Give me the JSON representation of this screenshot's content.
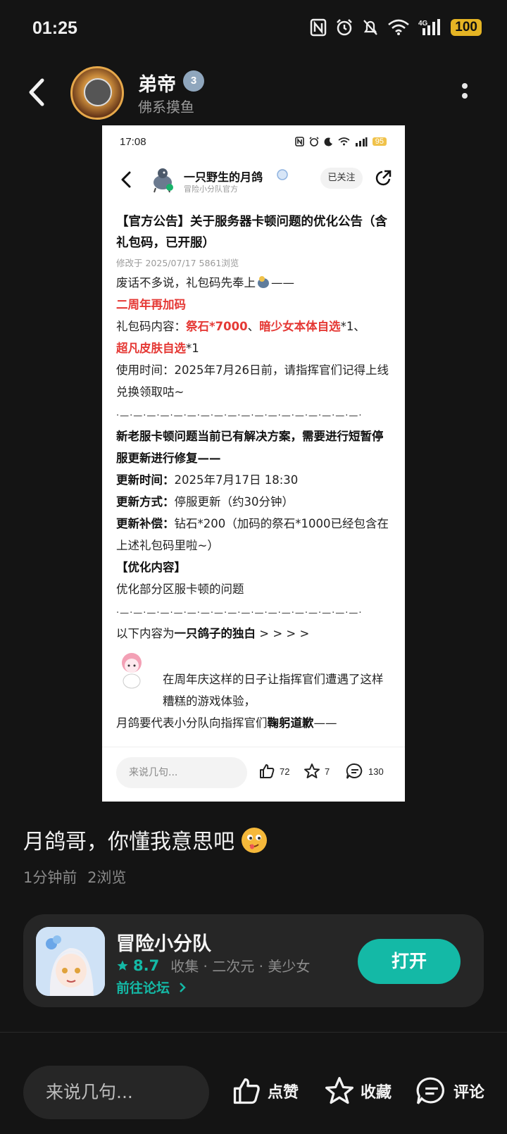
{
  "status_bar": {
    "time": "01:25",
    "network": "4G",
    "battery": "100"
  },
  "header": {
    "user_name": "弟帝",
    "level": "3",
    "user_subtitle": "佛系摸鱼"
  },
  "embedded_post": {
    "status_time": "17:08",
    "battery": "95",
    "author_name": "一只野生的月鸽",
    "author_subtitle": "冒险小分队官方",
    "follow_label": "已关注",
    "title": "【官方公告】关于服务器卡顿问题的优化公告（含礼包码，已开服）",
    "meta": "修改于 2025/07/17  5861浏览",
    "line1": "废话不多说，礼包码先奉上",
    "line1_tail": "——",
    "extra_code": "二周年再加码",
    "gift_prefix": "礼包码内容：",
    "gift_item1": "祭石*7000",
    "gift_sep": "、",
    "gift_item2": "暗少女本体自选",
    "gift_item2_tail": "*1、",
    "gift_item3": "超凡皮肤自选",
    "gift_item3_tail": "*1",
    "use_time": "使用时间：2025年7月26日前，请指挥官们记得上线兑换领取咕~",
    "dashes": "·—·—·—·—·—·—·—·—·—·—·—·—·—·—·—·—·—·—·",
    "server_heading": "新老服卡顿问题当前已有解决方案，需要进行短暂停服更新进行修复——",
    "update_time_label": "更新时间：",
    "update_time": "2025年7月17日 18:30",
    "update_method_label": "更新方式：",
    "update_method": "停服更新（约30分钟）",
    "update_comp_label": "更新补偿：",
    "update_comp": "钻石*200（加码的祭石*1000已经包含在上述礼包码里啦~）",
    "opt_heading": "【优化内容】",
    "opt_content": "优化部分区服卡顿的问题",
    "monologue_prefix": "以下内容为",
    "monologue_bold": "一只鸽子的独白",
    "monologue_tail": " > > > >",
    "para1": "在周年庆这样的日子让指挥官们遭遇了这样糟糕的游戏体验，",
    "para2_prefix": "月鸽要代表小分队向指挥官们",
    "para2_bold": "鞠躬道歉",
    "para2_tail": "——",
    "input_placeholder": "来说几句...",
    "likes": "72",
    "favorites": "7",
    "comments": "130"
  },
  "caption": "月鸽哥，你懂我意思吧",
  "post_meta": {
    "time_ago": "1分钟前",
    "views": "2浏览"
  },
  "game_card": {
    "name": "冒险小分队",
    "rating": "8.7",
    "tags": "收集 · 二次元 · 美少女",
    "forum_link": "前往论坛",
    "open_label": "打开"
  },
  "bottom_bar": {
    "input_placeholder": "来说几句...",
    "like_label": "点赞",
    "favorite_label": "收藏",
    "comment_label": "评论"
  },
  "colors": {
    "background": "#141414",
    "accent_teal": "#14b9a6",
    "highlight_red": "#e53935",
    "battery_yellow": "#e5b424"
  }
}
